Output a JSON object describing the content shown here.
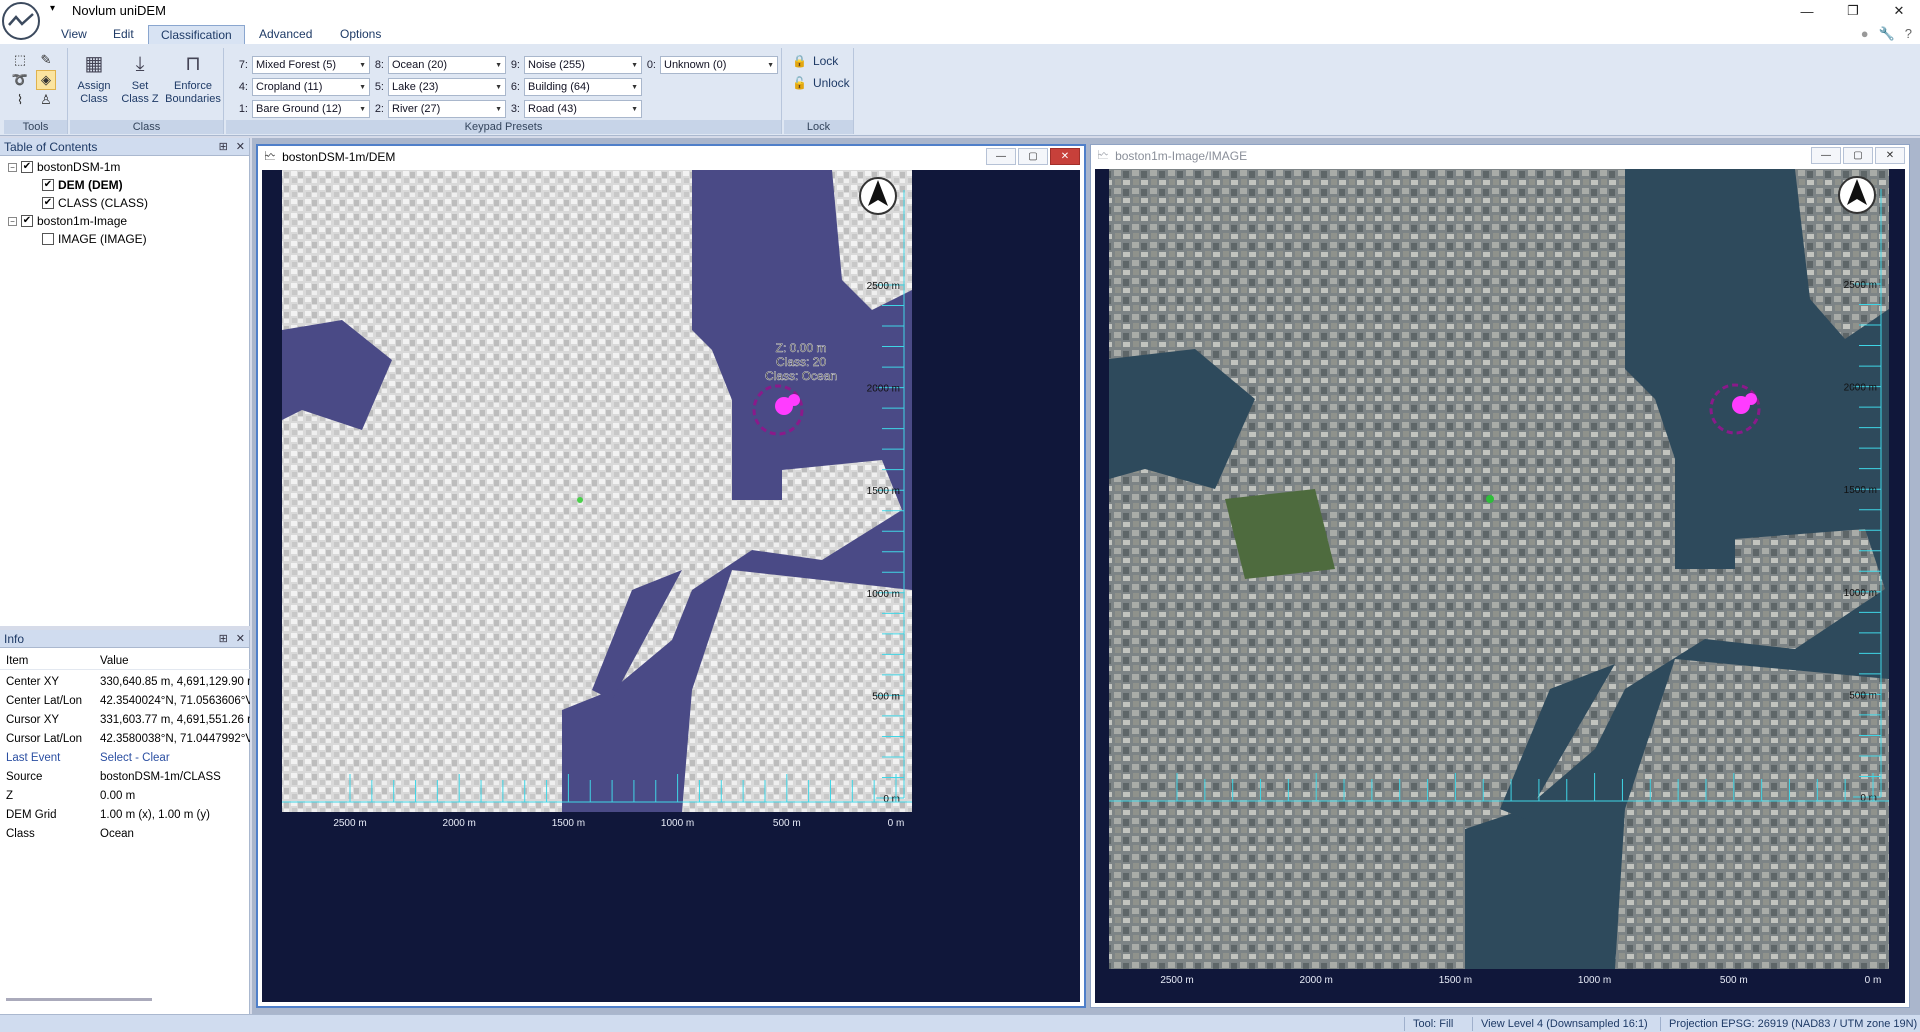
{
  "app": {
    "title": "Novlum uniDEM"
  },
  "tabs": [
    {
      "label": "View"
    },
    {
      "label": "Edit"
    },
    {
      "label": "Classification"
    },
    {
      "label": "Advanced"
    },
    {
      "label": "Options"
    }
  ],
  "ribbon": {
    "groups": {
      "tools": "Tools",
      "class": "Class",
      "keypad": "Keypad Presets",
      "lock": "Lock"
    },
    "class_buttons": [
      {
        "label": "Assign\nClass"
      },
      {
        "label": "Set\nClass Z"
      },
      {
        "label": "Enforce\nBoundaries"
      }
    ],
    "presets": [
      {
        "key": "7:",
        "value": "Mixed Forest (5)"
      },
      {
        "key": "8:",
        "value": "Ocean (20)"
      },
      {
        "key": "9:",
        "value": "Noise (255)"
      },
      {
        "key": "0:",
        "value": "Unknown (0)"
      },
      {
        "key": "4:",
        "value": "Cropland (11)"
      },
      {
        "key": "5:",
        "value": "Lake (23)"
      },
      {
        "key": "6:",
        "value": "Building (64)"
      },
      {
        "key": "1:",
        "value": "Bare Ground (12)"
      },
      {
        "key": "2:",
        "value": "River (27)"
      },
      {
        "key": "3:",
        "value": "Road (43)"
      }
    ],
    "lock_label": "Lock",
    "unlock_label": "Unlock"
  },
  "toc": {
    "title": "Table of Contents",
    "items": [
      {
        "label": "bostonDSM-1m",
        "checked": true
      },
      {
        "label": "DEM (DEM)",
        "checked": true
      },
      {
        "label": "CLASS (CLASS)",
        "checked": true
      },
      {
        "label": "boston1m-Image",
        "checked": true
      },
      {
        "label": "IMAGE (IMAGE)",
        "checked": false
      }
    ]
  },
  "info": {
    "title": "Info",
    "headers": {
      "item": "Item",
      "value": "Value"
    },
    "rows": [
      {
        "item": "Center XY",
        "value": "330,640.85 m, 4,691,129.90 r"
      },
      {
        "item": "Center Lat/Lon",
        "value": "42.3540024°N, 71.0563606°V"
      },
      {
        "item": "Cursor XY",
        "value": "331,603.77 m, 4,691,551.26 r"
      },
      {
        "item": "Cursor Lat/Lon",
        "value": "42.3580038°N, 71.0447992°V"
      },
      {
        "item": "Last Event",
        "value": "Select - Clear"
      },
      {
        "item": "Source",
        "value": "bostonDSM-1m/CLASS"
      },
      {
        "item": "Z",
        "value": "0.00 m"
      },
      {
        "item": "DEM Grid",
        "value": "1.00 m (x), 1.00 m (y)"
      },
      {
        "item": "Class",
        "value": "Ocean"
      }
    ]
  },
  "windows": [
    {
      "title": "bostonDSM-1m/DEM",
      "tooltip": {
        "z": "Z: 0.00 m",
        "class_num": "Class: 20",
        "class_name": "Class: Ocean"
      },
      "x_ticks": [
        "2500 m",
        "2000 m",
        "1500 m",
        "1000 m",
        "500 m",
        "0 m"
      ],
      "y_ticks": [
        "2500 m",
        "2000 m",
        "1500 m",
        "1000 m",
        "500 m",
        "0 m"
      ]
    },
    {
      "title": "boston1m-Image/IMAGE",
      "x_ticks": [
        "2500 m",
        "2000 m",
        "1500 m",
        "1000 m",
        "500 m",
        "0 m"
      ],
      "y_ticks": [
        "2500 m",
        "2000 m",
        "1500 m",
        "1000 m",
        "500 m",
        "0 m"
      ]
    }
  ],
  "status": {
    "tool": "Tool: Fill",
    "view": "View Level 4 (Downsampled 16:1)",
    "projection": "Projection EPSG: 26919 (NAD83 / UTM zone 19N)"
  },
  "colors": {
    "accent": "#4f7fc9",
    "water_dem": "#4a4a86",
    "ruler": "#3fd6e6",
    "marker": "#ff3cff"
  }
}
